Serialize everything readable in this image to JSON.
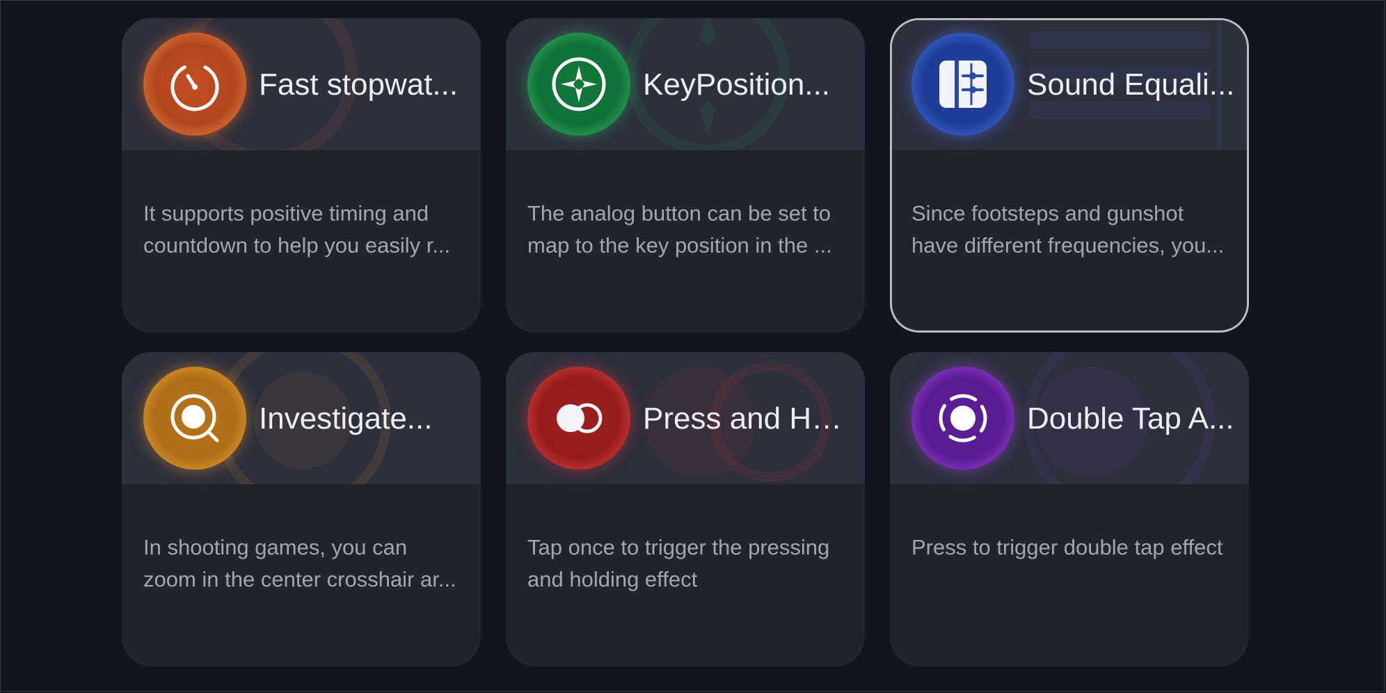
{
  "cards": [
    {
      "title": "Fast stopwat...",
      "description": "It supports positive timing and countdown to help you easily r...",
      "icon": "stopwatch-icon",
      "color": "#e0703a",
      "selected": false
    },
    {
      "title": "KeyPosition...",
      "description": "The analog button can be set to map to the key position in the ...",
      "icon": "joystick-icon",
      "color": "#2cac5a",
      "selected": false
    },
    {
      "title": "Sound Equali...",
      "description": "Since footsteps and gunshot have different frequencies, you...",
      "icon": "equalizer-icon",
      "color": "#3f6ad8",
      "selected": true
    },
    {
      "title": "Investigate...",
      "description": "In shooting games, you can zoom in the center crosshair ar...",
      "icon": "magnifier-icon",
      "color": "#e29b30",
      "selected": false
    },
    {
      "title": "Press and Ho...",
      "description": "Tap once to trigger the pressing and holding effect",
      "icon": "press-hold-icon",
      "color": "#d43c3c",
      "selected": false
    },
    {
      "title": "Double Tap A...",
      "description": "Press to trigger double tap effect",
      "icon": "double-tap-icon",
      "color": "#9240cf",
      "selected": false
    }
  ]
}
